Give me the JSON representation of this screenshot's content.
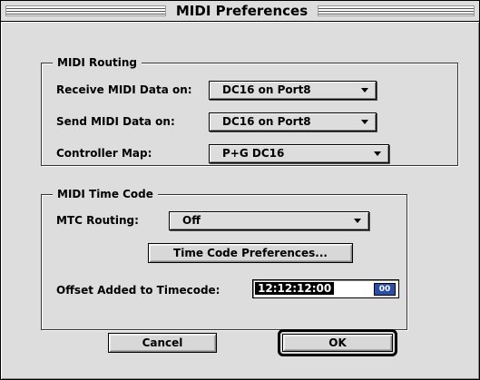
{
  "window": {
    "title": "MIDI Preferences"
  },
  "routing": {
    "legend": "MIDI Routing",
    "receive_label": "Receive MIDI Data on:",
    "receive_value": "DC16 on Port8",
    "send_label": "Send MIDI Data on:",
    "send_value": "DC16 on Port8",
    "controller_label": "Controller Map:",
    "controller_value": "P+G DC16"
  },
  "timecode": {
    "legend": "MIDI Time Code",
    "mtc_label": "MTC Routing:",
    "mtc_value": "Off",
    "prefs_button": "Time Code Preferences...",
    "offset_label": "Offset Added to Timecode:",
    "offset_value": "12:12:12:00",
    "frames_badge": "00"
  },
  "buttons": {
    "cancel": "Cancel",
    "ok": "OK"
  }
}
